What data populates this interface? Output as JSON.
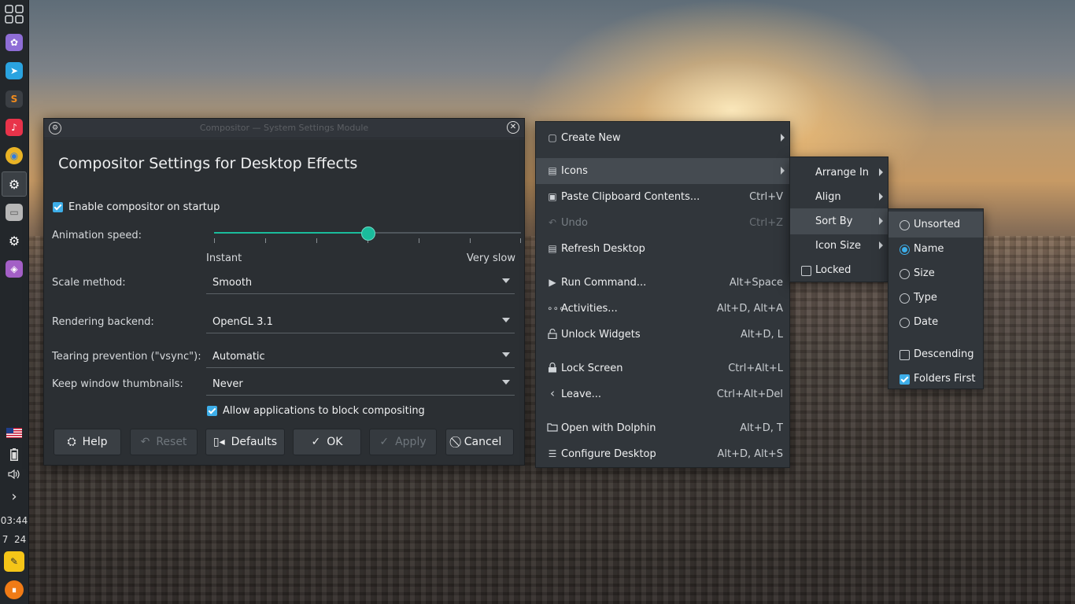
{
  "panel": {
    "launchers": [
      {
        "name": "app-grid-icon",
        "color": "#3b4045",
        "glyph": "▦"
      },
      {
        "name": "purple-app-icon",
        "color": "#8e6dd6",
        "glyph": "✿"
      },
      {
        "name": "telegram-icon",
        "color": "#2aa3e0",
        "glyph": "➤"
      },
      {
        "name": "sublime-icon",
        "color": "#f28b1c",
        "glyph": "S"
      },
      {
        "name": "music-icon",
        "color": "#e8334a",
        "glyph": "♪"
      },
      {
        "name": "chrome-icon",
        "color": "#e9b325",
        "glyph": "◉"
      },
      {
        "name": "system-settings-icon",
        "color": "#3b4045",
        "glyph": "⚙"
      },
      {
        "name": "file-manager-icon",
        "color": "#b7b7b7",
        "glyph": "▭"
      },
      {
        "name": "settings-icon",
        "color": "#3b4045",
        "glyph": "⚙"
      },
      {
        "name": "media-app-icon",
        "color": "#a35fc6",
        "glyph": "◈"
      }
    ],
    "tray": {
      "flag": "🇺🇸",
      "battery": "▮",
      "volume": "🔈",
      "expand": "›",
      "time": "03:44",
      "date": "7  24"
    },
    "bottom_icons": [
      {
        "name": "notes-icon",
        "color": "#f5c518",
        "glyph": "✎"
      },
      {
        "name": "pause-icon",
        "color": "#f07b16",
        "glyph": "⏸"
      }
    ]
  },
  "dialog": {
    "window_title": "Compositor — System Settings Module",
    "heading": "Compositor Settings for Desktop Effects",
    "enable_on_startup": {
      "label": "Enable compositor on startup",
      "checked": true
    },
    "animation_speed": {
      "label": "Animation speed:",
      "min_label": "Instant",
      "max_label": "Very slow",
      "value_fraction": 0.5
    },
    "scale_method": {
      "label": "Scale method:",
      "value": "Smooth"
    },
    "rendering_backend": {
      "label": "Rendering backend:",
      "value": "OpenGL 3.1"
    },
    "tearing_prevention": {
      "label": "Tearing prevention (\"vsync\"):",
      "value": "Automatic"
    },
    "keep_thumbnails": {
      "label": "Keep window thumbnails:",
      "value": "Never"
    },
    "allow_block": {
      "label": "Allow applications to block compositing",
      "checked": true
    },
    "buttons": {
      "help": "Help",
      "reset": "Reset",
      "defaults": "Defaults",
      "ok": "OK",
      "apply": "Apply",
      "cancel": "Cancel"
    }
  },
  "context_menu": {
    "items": [
      {
        "label": "Create New",
        "shortcut": "",
        "icon": "▢"
      },
      {
        "label": "Icons",
        "shortcut": "",
        "icon": "▤"
      },
      {
        "label": "Paste Clipboard Contents...",
        "shortcut": "Ctrl+V",
        "icon": "▣"
      },
      {
        "label": "Undo",
        "shortcut": "Ctrl+Z",
        "icon": "↶"
      },
      {
        "label": "Refresh Desktop",
        "shortcut": "",
        "icon": "▤"
      },
      {
        "label": "Run Command...",
        "shortcut": "Alt+Space",
        "icon": "▶"
      },
      {
        "label": "Activities...",
        "shortcut": "Alt+D, Alt+A",
        "icon": "∘∘∘"
      },
      {
        "label": "Unlock Widgets",
        "shortcut": "Alt+D, L",
        "icon": "🔓"
      },
      {
        "label": "Lock Screen",
        "shortcut": "Ctrl+Alt+L",
        "icon": "🔒"
      },
      {
        "label": "Leave...",
        "shortcut": "Ctrl+Alt+Del",
        "icon": "‹"
      },
      {
        "label": "Open with Dolphin",
        "shortcut": "Alt+D, T",
        "icon": "▭"
      },
      {
        "label": "Configure Desktop",
        "shortcut": "Alt+D, Alt+S",
        "icon": "☰"
      }
    ]
  },
  "icons_menu": {
    "items": [
      {
        "label": "Arrange In"
      },
      {
        "label": "Align"
      },
      {
        "label": "Sort By"
      },
      {
        "label": "Icon Size"
      },
      {
        "label": "Locked",
        "checked": false
      }
    ]
  },
  "sort_menu": {
    "items": [
      {
        "label": "Unsorted",
        "selected": false
      },
      {
        "label": "Name",
        "selected": true
      },
      {
        "label": "Size",
        "selected": false
      },
      {
        "label": "Type",
        "selected": false
      },
      {
        "label": "Date",
        "selected": false
      },
      {
        "label": "Descending",
        "checked": false
      },
      {
        "label": "Folders First",
        "checked": true
      }
    ]
  }
}
